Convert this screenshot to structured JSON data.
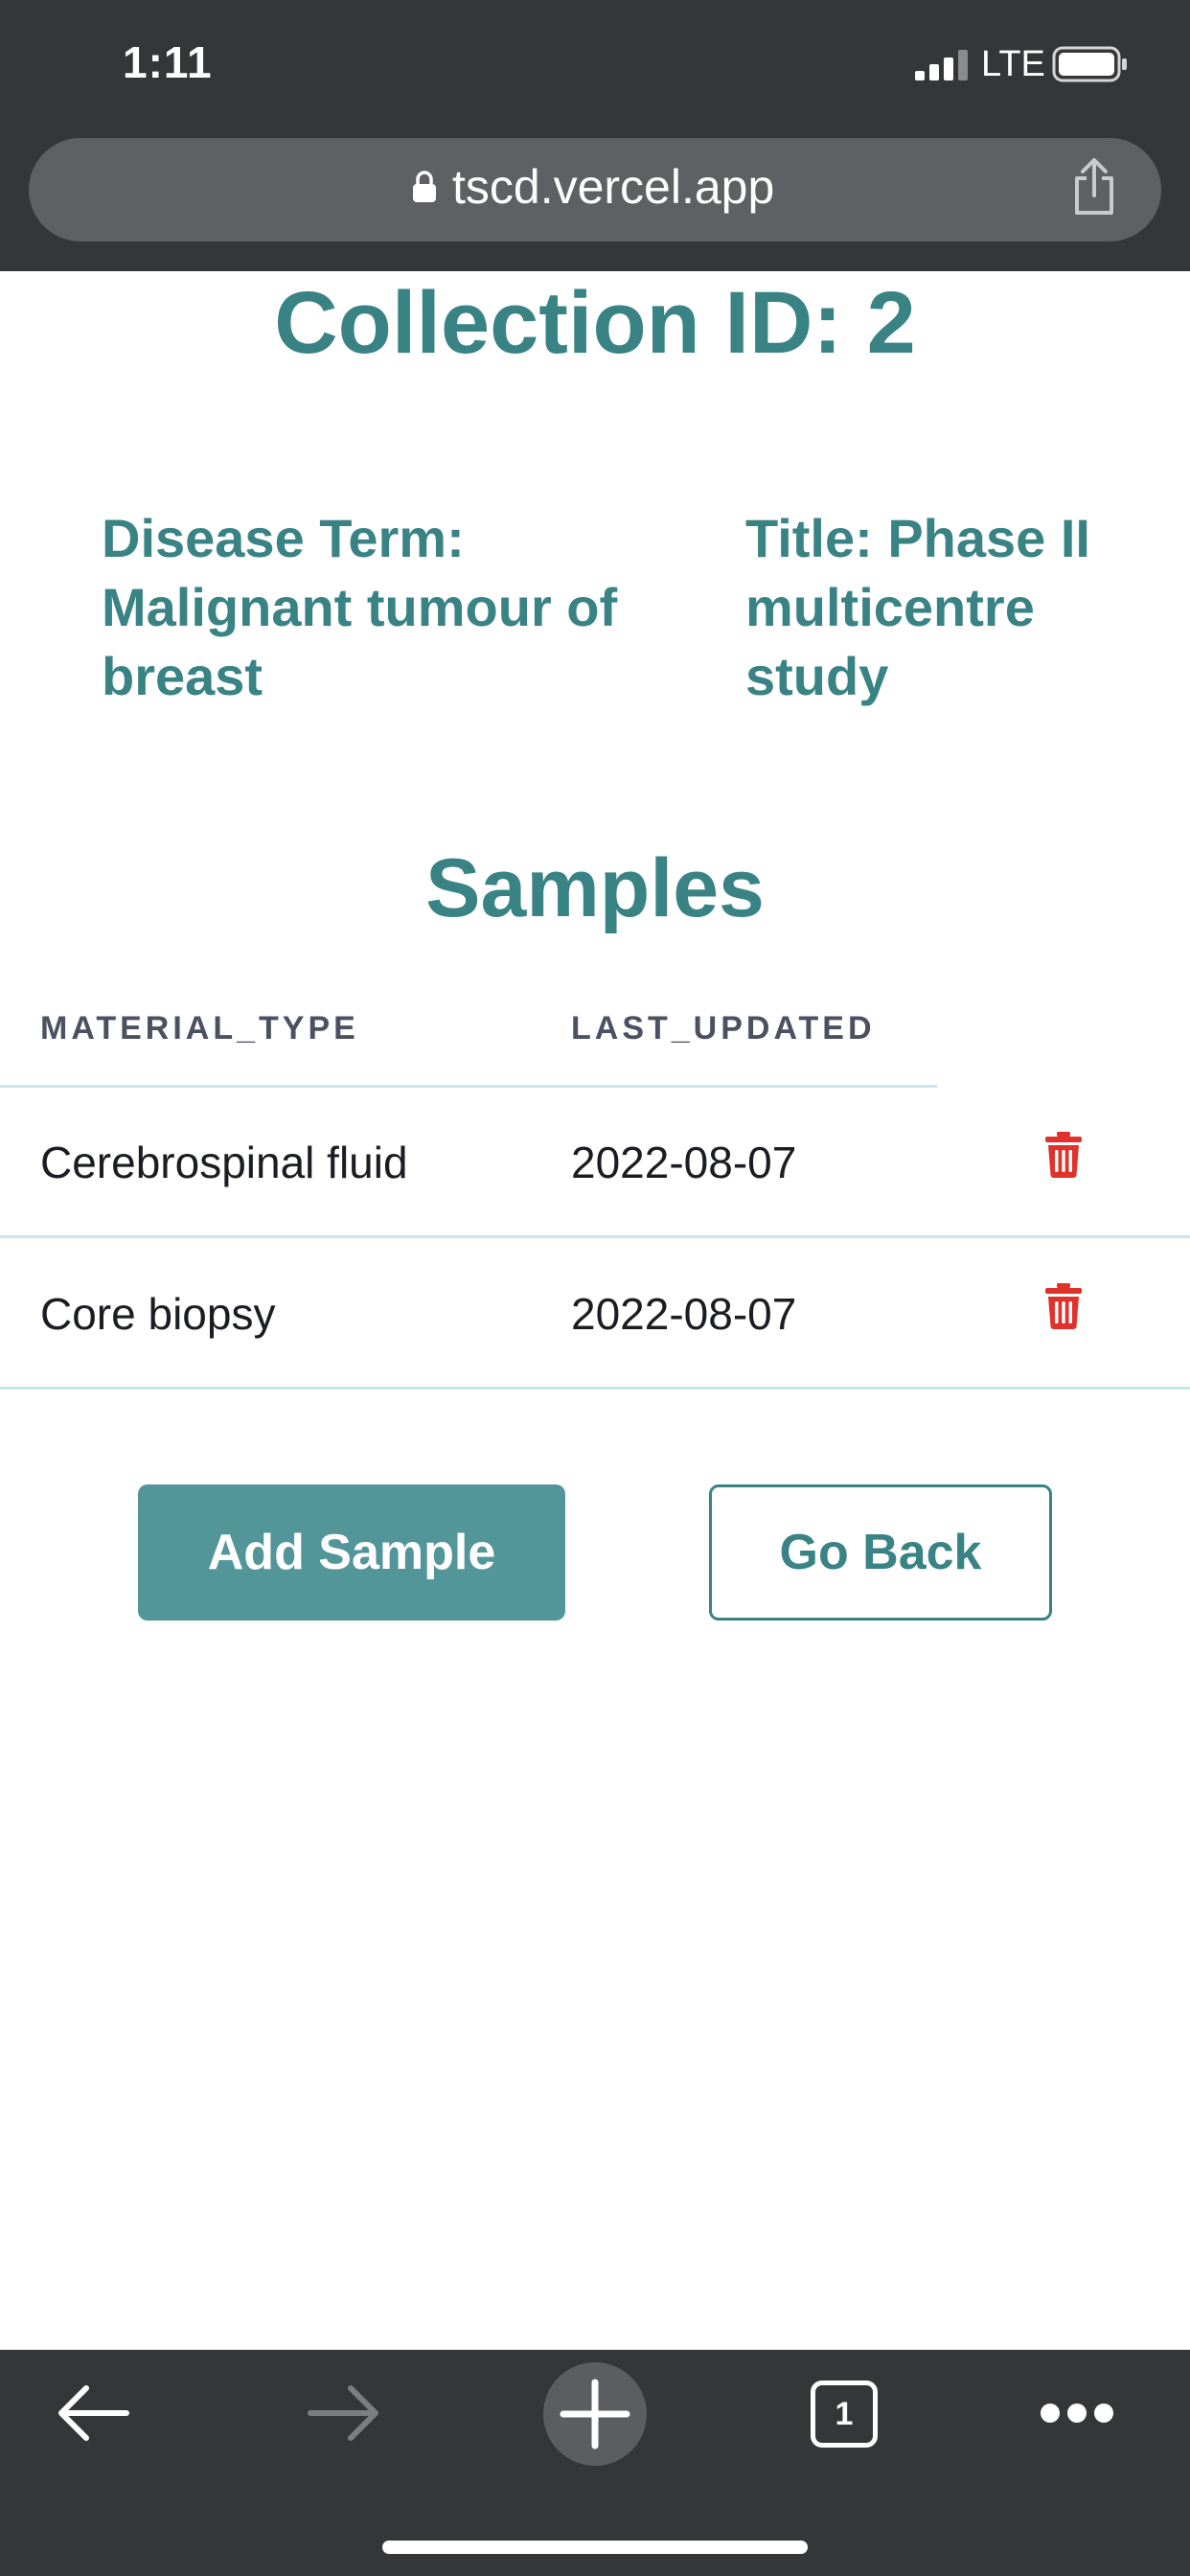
{
  "status_bar": {
    "time": "1:11",
    "network": "LTE"
  },
  "browser": {
    "url": "tscd.vercel.app"
  },
  "page": {
    "title": "Collection ID: 2",
    "disease_term": "Disease Term: Malignant tumour of breast",
    "collection_title": "Title: Phase II multicentre study",
    "samples_heading": "Samples"
  },
  "table": {
    "columns": [
      "MATERIAL_TYPE",
      "LAST_UPDATED"
    ],
    "rows": [
      {
        "material_type": "Cerebrospinal fluid",
        "last_updated": "2022-08-07"
      },
      {
        "material_type": "Core biopsy",
        "last_updated": "2022-08-07"
      }
    ]
  },
  "buttons": {
    "add_sample": "Add Sample",
    "go_back": "Go Back"
  },
  "toolbar": {
    "tab_count": "1"
  },
  "colors": {
    "accent": "#3a8385",
    "button_fill": "#53969a",
    "delete": "#e0322a",
    "chrome": "#353638"
  }
}
